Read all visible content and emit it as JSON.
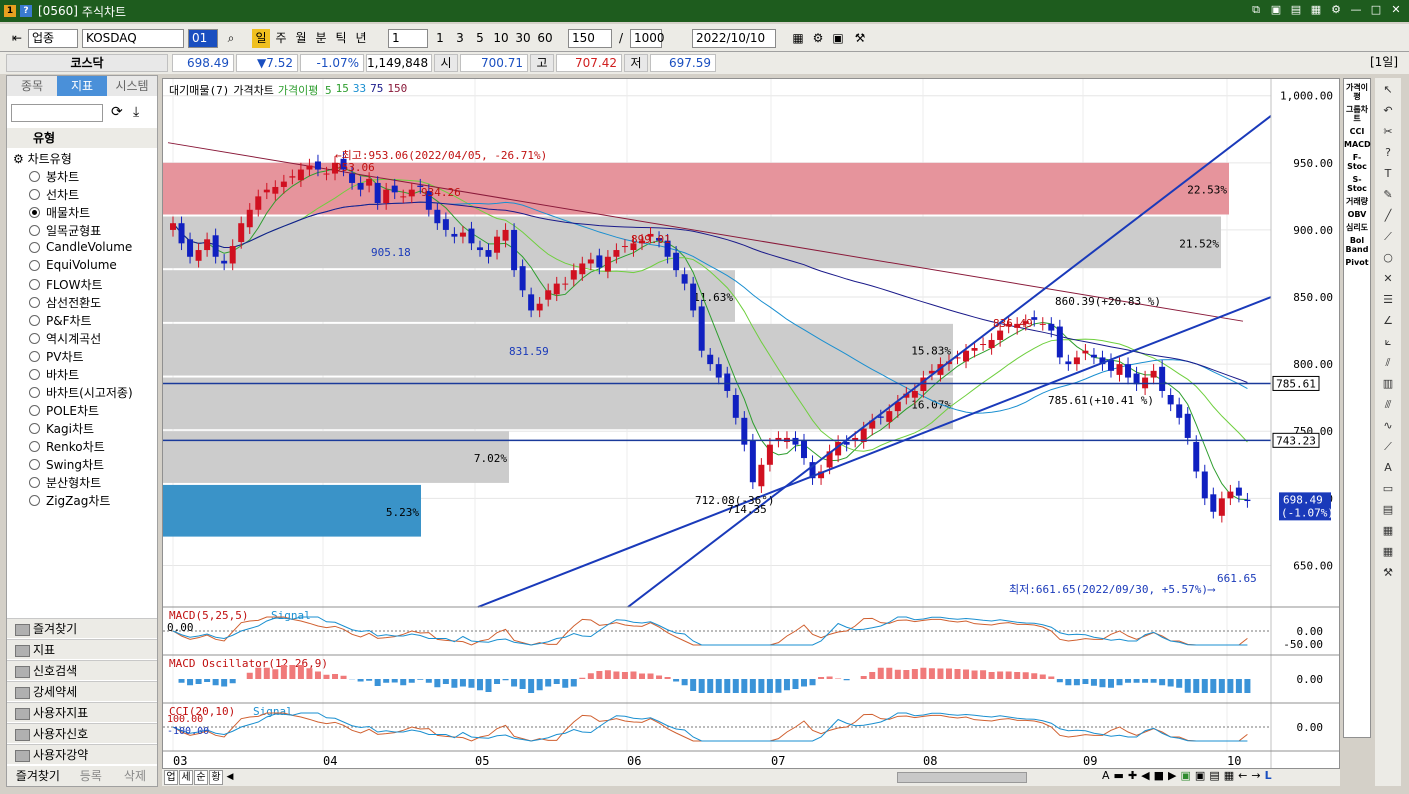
{
  "window": {
    "code": "[0560]",
    "title": "주식차트",
    "badge": "1"
  },
  "toolbar": {
    "market_type": "업종",
    "index_name": "KOSDAQ",
    "code_field": "01",
    "periods": [
      "일",
      "주",
      "월",
      "분",
      "틱",
      "년"
    ],
    "interval_value": "1",
    "interval_presets": [
      "1",
      "3",
      "5",
      "10",
      "30",
      "60"
    ],
    "count_value": "150",
    "count_separator": "/",
    "count_total": "1000",
    "date": "2022/10/10"
  },
  "quote": {
    "name": "코스닥",
    "price": "698.49",
    "change": "▼7.52",
    "change_pct": "-1.07%",
    "volume": "1,149,848",
    "open_label": "시",
    "open": "700.71",
    "high_label": "고",
    "high": "707.42",
    "low_label": "저",
    "low": "697.59",
    "period_badge": "[1일]"
  },
  "sidebar": {
    "tabs": [
      "종목",
      "지표",
      "시스템"
    ],
    "section": "유형",
    "tree_root": "차트유형",
    "chart_types": [
      "봉차트",
      "선차트",
      "매물차트",
      "일목균형표",
      "CandleVolume",
      "EquiVolume",
      "FLOW차트",
      "삼선전환도",
      "P&F차트",
      "역시계곡선",
      "PV차트",
      "바차트",
      "바차트(시고저종)",
      "POLE차트",
      "Kagi차트",
      "Renko차트",
      "Swing차트",
      "분산형차트",
      "ZigZag차트"
    ],
    "selected_index": 2,
    "folders": [
      "즐겨찾기",
      "지표",
      "신호검색",
      "강세약세",
      "사용자지표",
      "사용자신호",
      "사용자강약"
    ],
    "bottom_tabs": [
      "즐겨찾기",
      "등록",
      "삭제"
    ]
  },
  "legend": {
    "items": [
      "대기매물(7)",
      "가격차트",
      "가격이평 5",
      "15",
      "33",
      "75",
      "150"
    ],
    "colors": [
      "#000000",
      "#000000",
      "#2e9e2e",
      "#2e9e2e",
      "#1a8fd0",
      "#1a1a8a",
      "#8a1a3a"
    ]
  },
  "price_axis": {
    "ticks": [
      "1,000.00",
      "950.00",
      "900.00",
      "850.00",
      "800.00",
      "750.00",
      "700.00",
      "650.00"
    ],
    "tags": [
      "785.61",
      "743.23",
      "698.49",
      "(-1.07%)"
    ]
  },
  "annotations": {
    "high_label": "←최고:953.06(2022/04/05, -26.71%)",
    "low_label": "최저:661.65(2022/09/30, +5.57%)⟶",
    "peaks": [
      "953.06",
      "934.26",
      "905.18",
      "899.01",
      "831.59",
      "836.49",
      "712.08(-36°)",
      "714.35",
      "860.39(+20.83 %)",
      "785.61(+10.41 %)",
      "661.65"
    ],
    "volume_bands": [
      "22.53%",
      "21.52%",
      "11.63%",
      "15.83%",
      "16.07%",
      "7.02%",
      "5.23%"
    ]
  },
  "sub_charts": [
    {
      "label": "MACD(5,25,5)",
      "signal": "Signal",
      "values": [
        "0.00",
        "-50.00"
      ],
      "left_value": "0.00"
    },
    {
      "label": "MACD Oscillator(12,26,9)",
      "values": [
        "0.00"
      ]
    },
    {
      "label": "CCI(20,10)",
      "signal": "Signal",
      "values": [
        "0.00"
      ],
      "left_values": [
        "100.00",
        "-100.00"
      ]
    }
  ],
  "time_axis": {
    "labels": [
      "03",
      "04",
      "05",
      "06",
      "07",
      "08",
      "09",
      "10"
    ]
  },
  "bottom": {
    "buttons": [
      "업",
      "세",
      "순",
      "황"
    ]
  },
  "indicator_panel": [
    "가격이평",
    "그룹차트",
    "CCI",
    "MACD",
    "F-Stoc",
    "S-Stoc",
    "거래량",
    "OBV",
    "심리도",
    "Bol Band",
    "Pivot"
  ]
}
